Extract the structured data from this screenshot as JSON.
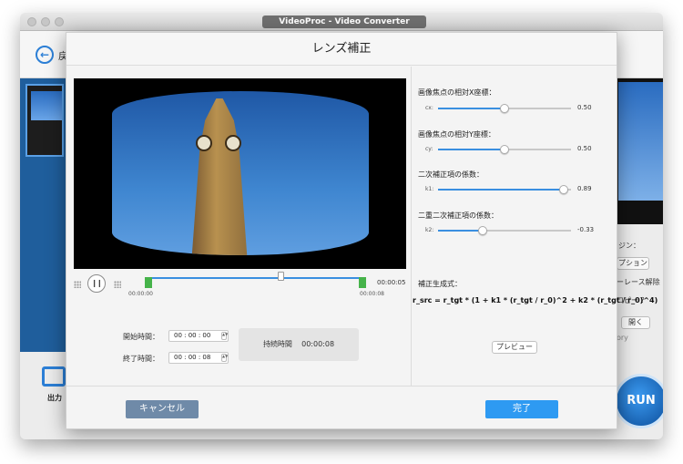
{
  "app": {
    "title": "VideoProc - Video Converter",
    "back_label": "戻",
    "output_label": "出力",
    "run_label": "RUN"
  },
  "right_panel": {
    "label1": "ジン：",
    "btn1": "プション",
    "label2": "ーレース解除",
    "label3": "コピー ？",
    "btn2": "開く",
    "label4": "ory"
  },
  "dialog": {
    "title": "レンズ補正",
    "playback": {
      "start_tick": "00:00:00",
      "end_tick": "00:00:08",
      "total": "00:00:05",
      "progress": 0.62
    },
    "start_time": {
      "label": "開始時間：",
      "value": "00 : 00 : 00"
    },
    "end_time": {
      "label": "終了時間：",
      "value": "00 : 00 : 08"
    },
    "duration": {
      "label": "持続時間",
      "value": "00:00:08"
    },
    "params": [
      {
        "title": "画像焦点の相対X座標：",
        "key": "cx:",
        "value": "0.50",
        "fraction": 0.5
      },
      {
        "title": "画像焦点の相対Y座標：",
        "key": "cy:",
        "value": "0.50",
        "fraction": 0.5
      },
      {
        "title": "二次補正項の係数：",
        "key": "k1:",
        "value": "0.89",
        "fraction": 0.945
      },
      {
        "title": "二重二次補正項の係数：",
        "key": "k2:",
        "value": "-0.33",
        "fraction": 0.335
      }
    ],
    "formula_label": "補正生成式：",
    "formula": "r_src = r_tgt * (1 + k1 * (r_tgt / r_0)^2 + k2 * (r_tgt / r_0)^4)",
    "preview_button": "プレビュー",
    "cancel_button": "キャンセル",
    "done_button": "完了"
  },
  "colors": {
    "accent": "#2e9af2",
    "cancel": "#6f8aa8",
    "trim": "#46b34a"
  }
}
